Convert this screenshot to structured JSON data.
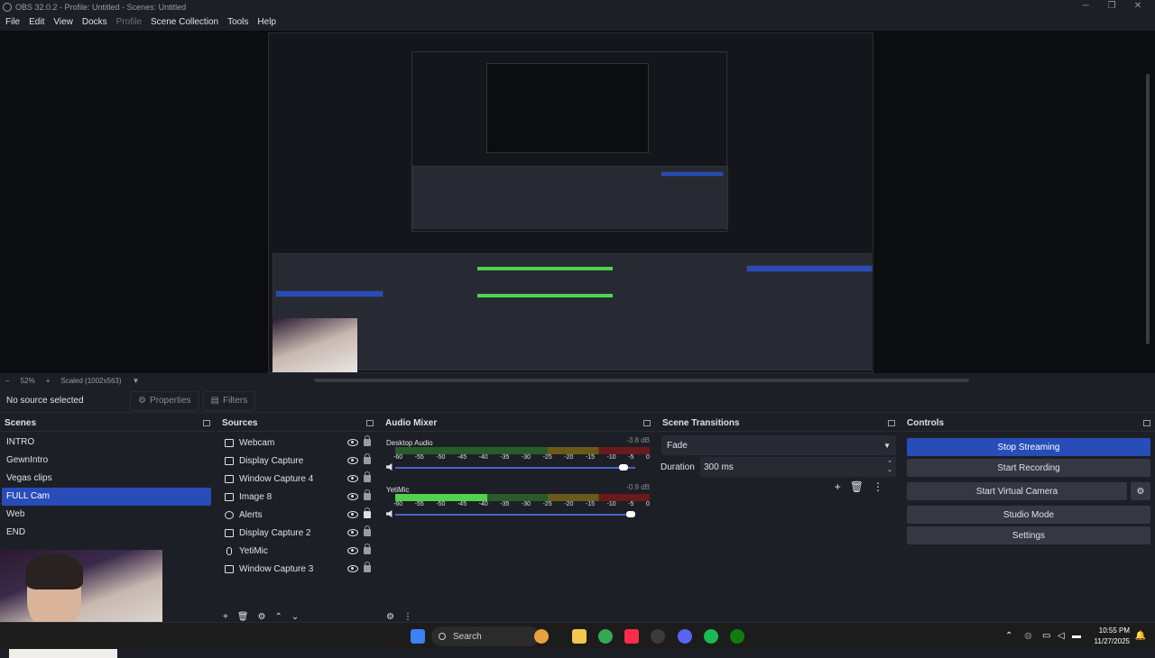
{
  "window": {
    "title": "OBS 32.0.2 - Profile: Untitled - Scenes: Untitled"
  },
  "menu": [
    "File",
    "Edit",
    "View",
    "Docks",
    "Profile",
    "Scene Collection",
    "Tools",
    "Help"
  ],
  "zoom": {
    "percent": "52%",
    "scale": "Scaled (1002x563)"
  },
  "context": {
    "no_source": "No source selected",
    "properties": "Properties",
    "filters": "Filters"
  },
  "scenes": {
    "title": "Scenes",
    "items": [
      "INTRO",
      "GewnIntro",
      "Vegas clips",
      "FULL Cam",
      "Web",
      "END"
    ],
    "active_index": 3
  },
  "sources": {
    "title": "Sources",
    "items": [
      "Webcam",
      "Display Capture",
      "Window Capture 4",
      "Image 8",
      "Alerts",
      "Display Capture 2",
      "YetiMic",
      "Window Capture 3"
    ]
  },
  "mixer": {
    "title": "Audio Mixer",
    "channels": [
      {
        "name": "Desktop Audio",
        "db": "-3.8 dB",
        "level": 0.0,
        "volume": 0.97
      },
      {
        "name": "YetiMic",
        "db": "-0.9 dB",
        "level": 0.36,
        "volume": 1.0
      }
    ],
    "ticks": [
      "-60",
      "-55",
      "-50",
      "-45",
      "-40",
      "-35",
      "-30",
      "-25",
      "-20",
      "-15",
      "-10",
      "-5",
      "0"
    ]
  },
  "transitions": {
    "title": "Scene Transitions",
    "type": "Fade",
    "duration_label": "Duration",
    "duration": "300 ms"
  },
  "controls": {
    "title": "Controls",
    "stop_streaming": "Stop Streaming",
    "start_recording": "Start Recording",
    "start_virtual_camera": "Start Virtual Camera",
    "studio_mode": "Studio Mode",
    "settings": "Settings"
  },
  "taskbar": {
    "search": "Search",
    "time": "10:55 PM",
    "date": "11/27/2025"
  },
  "colors": {
    "accent": "#284cb8",
    "panel": "#272a33",
    "bg": "#1d1f26"
  }
}
